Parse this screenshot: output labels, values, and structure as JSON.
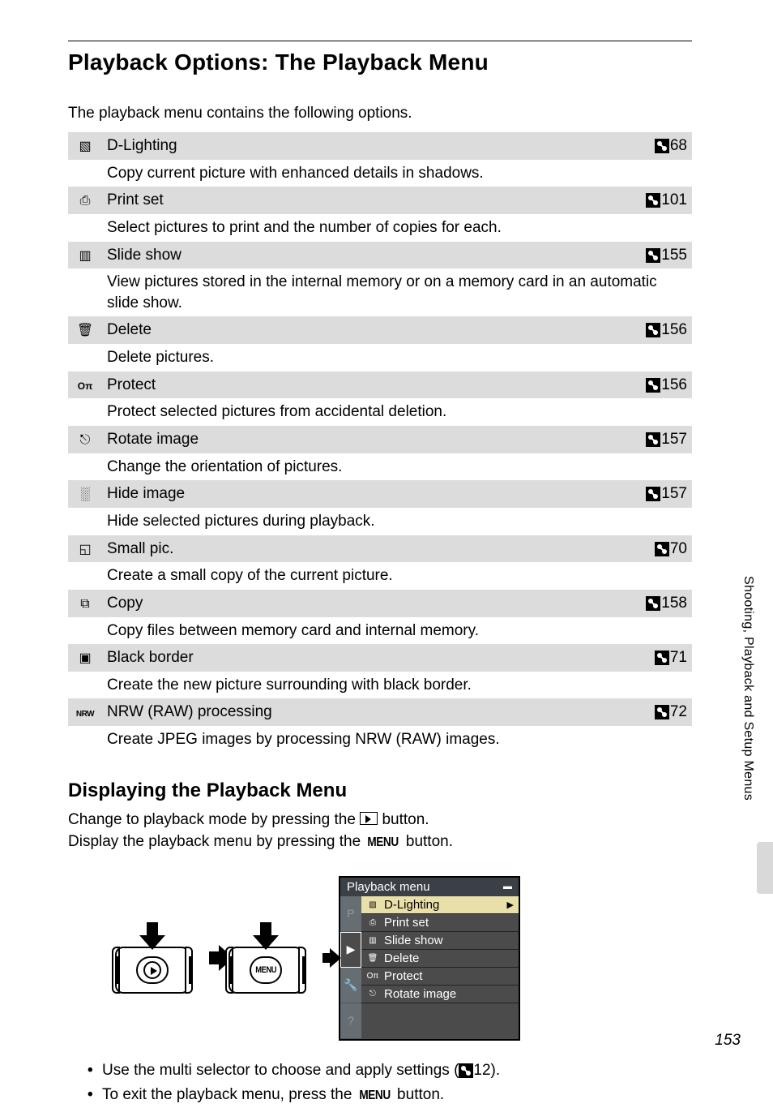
{
  "heading": "Playback Options: The Playback Menu",
  "intro": "The playback menu contains the following options.",
  "options": [
    {
      "icon": "d-lighting-icon",
      "name": "D-Lighting",
      "page": "68",
      "description": "Copy current picture with enhanced details in shadows."
    },
    {
      "icon": "print-set-icon",
      "name": "Print set",
      "page": "101",
      "description": "Select pictures to print and the number of copies for each."
    },
    {
      "icon": "slide-show-icon",
      "name": "Slide show",
      "page": "155",
      "description": "View pictures stored in the internal memory or on a memory card in an automatic slide show."
    },
    {
      "icon": "delete-icon",
      "name": "Delete",
      "page": "156",
      "description": "Delete pictures."
    },
    {
      "icon": "protect-icon",
      "name": "Protect",
      "page": "156",
      "description": "Protect selected pictures from accidental deletion."
    },
    {
      "icon": "rotate-image-icon",
      "name": "Rotate image",
      "page": "157",
      "description": "Change the orientation of pictures."
    },
    {
      "icon": "hide-image-icon",
      "name": "Hide image",
      "page": "157",
      "description": "Hide selected pictures during playback."
    },
    {
      "icon": "small-pic-icon",
      "name": "Small pic.",
      "page": "70",
      "description": "Create a small copy of the current picture."
    },
    {
      "icon": "copy-icon",
      "name": "Copy",
      "page": "158",
      "description": "Copy files between memory card and internal memory."
    },
    {
      "icon": "black-border-icon",
      "name": "Black border",
      "page": "71",
      "description": "Create the new picture surrounding with black border."
    },
    {
      "icon": "nrw-raw-icon",
      "name": "NRW (RAW) processing",
      "page": "72",
      "description": "Create JPEG images by processing NRW (RAW) images."
    }
  ],
  "sub_heading": "Displaying the Playback Menu",
  "body_lines": {
    "line1_a": "Change to playback mode by pressing the ",
    "line1_b": " button.",
    "line2_a": "Display the playback menu by pressing the ",
    "line2_b": " button."
  },
  "menu_label": "MENU",
  "screen": {
    "title": "Playback menu",
    "items": [
      {
        "label": "D-Lighting",
        "selected": true
      },
      {
        "label": "Print set",
        "selected": false
      },
      {
        "label": "Slide show",
        "selected": false
      },
      {
        "label": "Delete",
        "selected": false
      },
      {
        "label": "Protect",
        "selected": false
      },
      {
        "label": "Rotate image",
        "selected": false
      }
    ],
    "sidebar": [
      "P",
      "▶",
      "🔧",
      "?"
    ]
  },
  "bullets": {
    "b1_a": "Use the multi selector to choose and apply settings (",
    "b1_page": "12",
    "b1_b": ").",
    "b2_a": "To exit the playback menu, press the ",
    "b2_b": " button."
  },
  "side_tab": "Shooting, Playback and Setup Menus",
  "page_number": "153"
}
